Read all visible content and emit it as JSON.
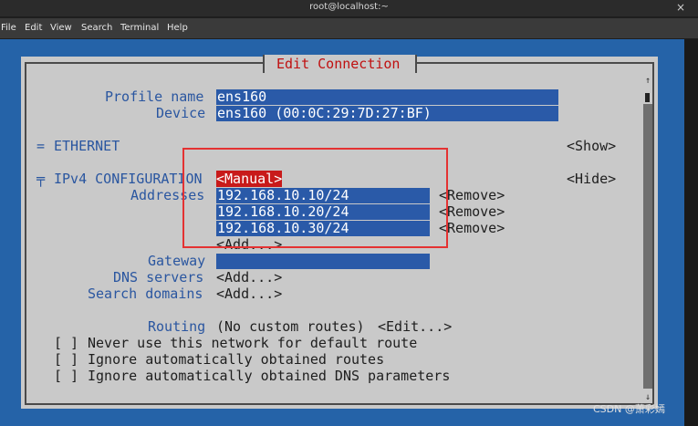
{
  "window": {
    "title": "root@localhost:~",
    "close_glyph": "×"
  },
  "menu": [
    "File",
    "Edit",
    "View",
    "Search",
    "Terminal",
    "Help"
  ],
  "dialog": {
    "title": "Edit Connection",
    "profile_name_label": "Profile name",
    "profile_name_value": "ens160",
    "device_label": "Device",
    "device_value": "ens160 (00:0C:29:7D:27:BF)",
    "ethernet_marker": "=",
    "ethernet_label": "ETHERNET",
    "ethernet_action": "<Show>",
    "ipv4_marker": "╤",
    "ipv4_label": "IPv4 CONFIGURATION",
    "ipv4_mode": "<Manual>",
    "ipv4_action": "<Hide>",
    "addresses_label": "Addresses",
    "addresses": [
      {
        "value": "192.168.10.10/24",
        "remove": "<Remove>"
      },
      {
        "value": "192.168.10.20/24",
        "remove": "<Remove>"
      },
      {
        "value": "192.168.10.30/24",
        "remove": "<Remove>"
      }
    ],
    "add_address": "<Add...>",
    "gateway_label": "Gateway",
    "gateway_value": "",
    "dns_label": "DNS servers",
    "dns_add": "<Add...>",
    "search_label": "Search domains",
    "search_add": "<Add...>",
    "routing_label": "Routing",
    "routing_value": "(No custom routes)",
    "routing_edit": "<Edit...>",
    "checkboxes": [
      {
        "box": "[ ]",
        "label": "Never use this network for default route"
      },
      {
        "box": "[ ]",
        "label": "Ignore automatically obtained routes"
      },
      {
        "box": "[ ]",
        "label": "Ignore automatically obtained DNS parameters"
      }
    ],
    "scroll_up": "↑",
    "scroll_down": "↓"
  },
  "watermark": "CSDN @萧彩嫣",
  "colors": {
    "screen_bg": "#2563a8",
    "panel_bg": "#c9c9c9",
    "label": "#2a56a0",
    "field_bg": "#2a5aa8",
    "selected_bg": "#c81a1a",
    "annotation_box": "#e43232"
  }
}
